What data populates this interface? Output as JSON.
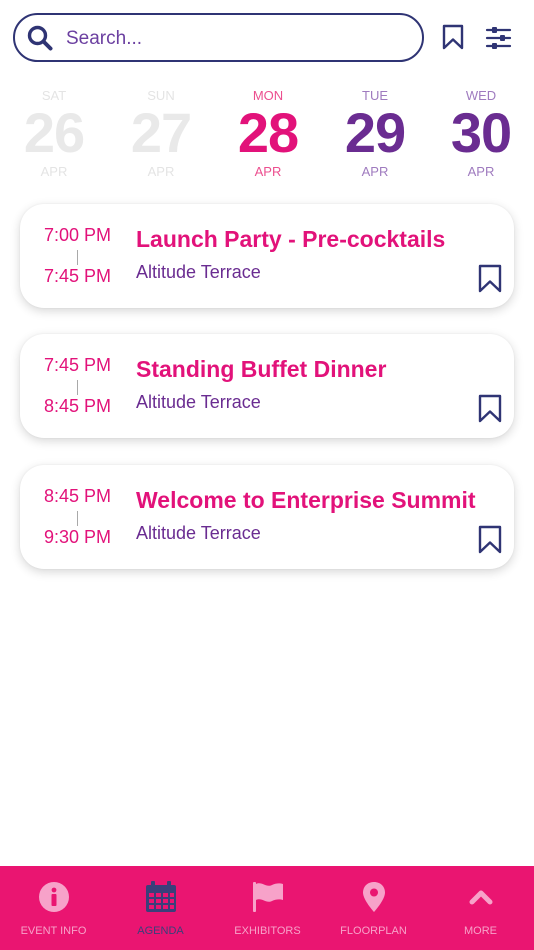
{
  "header": {
    "search_placeholder": "Search...",
    "icons": [
      "search-icon",
      "bookmark-icon",
      "filter-sliders-icon"
    ]
  },
  "dates": [
    {
      "dow": "SAT",
      "day": "26",
      "month": "APR",
      "state": "past"
    },
    {
      "dow": "SUN",
      "day": "27",
      "month": "APR",
      "state": "past"
    },
    {
      "dow": "MON",
      "day": "28",
      "month": "APR",
      "state": "selected"
    },
    {
      "dow": "TUE",
      "day": "29",
      "month": "APR",
      "state": "upcoming"
    },
    {
      "dow": "WED",
      "day": "30",
      "month": "APR",
      "state": "upcoming"
    }
  ],
  "sessions": [
    {
      "start": "7:00 PM",
      "end": "7:45 PM",
      "title": "Launch Party - Pre-cocktails",
      "venue": "Altitude Terrace"
    },
    {
      "start": "7:45 PM",
      "end": "8:45 PM",
      "title": "Standing Buffet Dinner",
      "venue": "Altitude Terrace"
    },
    {
      "start": "8:45 PM",
      "end": "9:30 PM",
      "title": "Welcome to Enterprise Summit",
      "venue": "Altitude Terrace"
    }
  ],
  "nav": [
    {
      "label": "EVENT INFO",
      "icon": "info-icon",
      "active": false
    },
    {
      "label": "AGENDA",
      "icon": "calendar-icon",
      "active": true
    },
    {
      "label": "EXHIBITORS",
      "icon": "flag-icon",
      "active": false
    },
    {
      "label": "FLOORPLAN",
      "icon": "map-pin-icon",
      "active": false
    },
    {
      "label": "MORE",
      "icon": "chevron-up-icon",
      "active": false
    }
  ],
  "colors": {
    "accent_pink": "#e2127a",
    "accent_purple": "#6a2c91",
    "navy": "#2f3474",
    "nav_bg": "#ea1571"
  }
}
